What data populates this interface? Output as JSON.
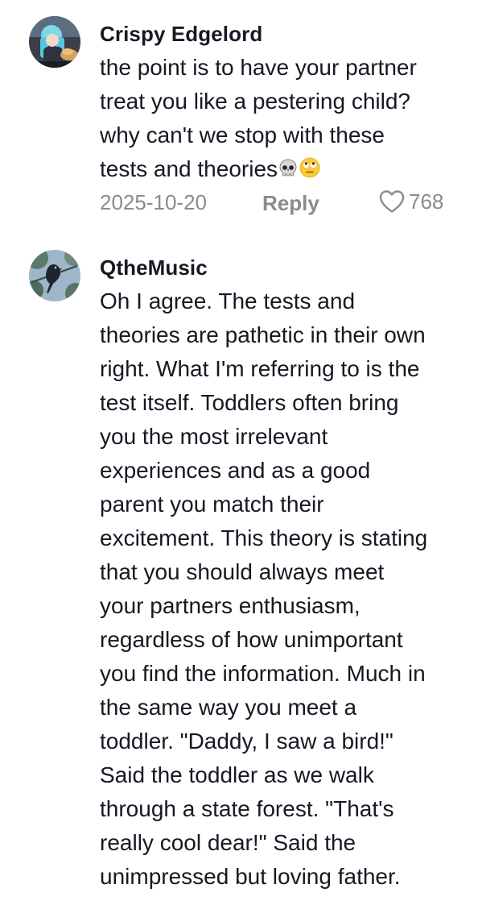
{
  "comments": [
    {
      "author": "Crispy Edgelord",
      "avatar_icon": "anime-character-avatar",
      "lines": [
        "the point is to have your partner",
        "treat you like a pestering child?",
        "why can't we stop with these",
        "tests and theories"
      ],
      "emojis": [
        "skull-emoji",
        "eye-roll-emoji"
      ],
      "date": "2025-10-20",
      "reply_label": "Reply",
      "like_icon": "heart-outline-icon",
      "like_count": "768"
    },
    {
      "author": "QtheMusic",
      "avatar_icon": "bird-in-trees-avatar",
      "lines": [
        "Oh I agree. The tests and",
        "theories are pathetic in their own",
        "right. What I'm referring to is the",
        "test itself. Toddlers often bring",
        "you the most irrelevant",
        "experiences and as a good",
        "parent you match their",
        "excitement. This theory is stating",
        "that you should always meet",
        "your partners enthusiasm,",
        "regardless of how unimportant",
        "you find the information. Much in",
        "the same way you meet a",
        "toddler. \"Daddy, I saw a bird!\"",
        "Said the toddler as we walk",
        "through a state forest. \"That's",
        "really cool dear!\" Said the",
        "unimpressed but loving father."
      ]
    }
  ],
  "colors": {
    "text_primary": "#161823",
    "text_secondary": "#8a8b91"
  }
}
